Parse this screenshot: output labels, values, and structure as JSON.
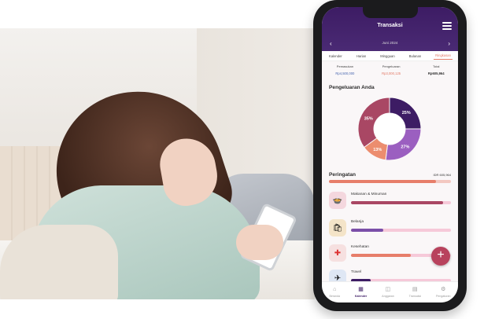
{
  "app": {
    "title": "Transaksi",
    "month": "Juni 2024",
    "tabs": [
      {
        "label": "Kalender"
      },
      {
        "label": "Harian"
      },
      {
        "label": "Mingguan"
      },
      {
        "label": "Bulanan"
      },
      {
        "label": "Ringkasan"
      }
    ],
    "summary": {
      "income_label": "Pemasukan",
      "income_value": "Rp4,500,000",
      "expense_label": "Pengeluaran",
      "expense_value": "Rp3,000,125",
      "total_label": "Total",
      "total_value": "Rp605,964"
    },
    "chart_title": "Pengeluaran Anda",
    "chart_data": {
      "type": "pie",
      "values": [
        25,
        27,
        13,
        35
      ],
      "labels": [
        "25%",
        "27%",
        "13%",
        "35%"
      ],
      "colors": [
        "#3d1c64",
        "#9b5fc0",
        "#ec8d6f",
        "#a94764"
      ]
    },
    "alert": {
      "title": "Peringatan",
      "amount": "IDR 605,964",
      "progress": 0.88
    },
    "categories": [
      {
        "name": "Makanan & Minuman",
        "progress": 0.92,
        "icon": "food-icon",
        "color": "#a94764"
      },
      {
        "name": "Belanja",
        "progress": 0.32,
        "icon": "shopping-icon",
        "color": "#7b4fa8"
      },
      {
        "name": "Kesehatan",
        "progress": 0.6,
        "icon": "health-icon",
        "color": "#e77e6a"
      },
      {
        "name": "Travel",
        "progress": 0.2,
        "icon": "travel-icon",
        "color": "#3d1c64"
      }
    ],
    "fab_label": "+",
    "nav": [
      {
        "label": "Beranda",
        "icon": "home-icon"
      },
      {
        "label": "Kalender",
        "icon": "calendar-icon"
      },
      {
        "label": "Anggaran",
        "icon": "budget-icon"
      },
      {
        "label": "Transaksi",
        "icon": "transactions-icon"
      },
      {
        "label": "Pengaturan",
        "icon": "gear-icon"
      }
    ]
  }
}
